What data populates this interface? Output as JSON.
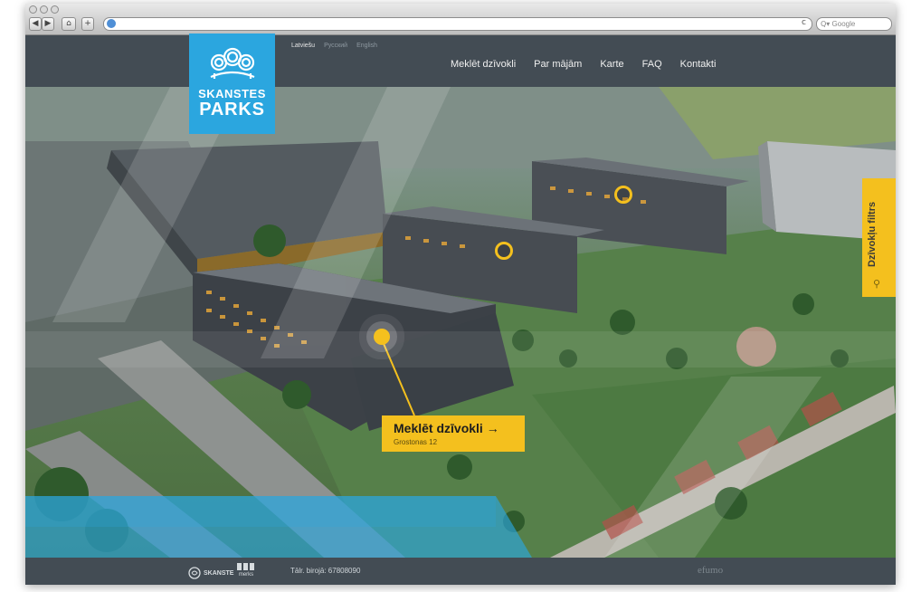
{
  "browser": {
    "url_value": "",
    "search_placeholder": "Google",
    "back_label": "◀",
    "forward_label": "▶",
    "home_label": "⌂",
    "add_label": "+",
    "reload_label": "c"
  },
  "brand": {
    "line1": "SKANSTES",
    "line2": "PARKS",
    "color": "#2ba6df"
  },
  "languages": [
    "Latviešu",
    "Русский",
    "English"
  ],
  "nav": {
    "items": [
      "Meklēt dzīvokli",
      "Par mājām",
      "Karte",
      "FAQ",
      "Kontakti"
    ]
  },
  "callout": {
    "title": "Meklēt dzīvokli →",
    "subtitle": "Grostonas 12",
    "color": "#f4c01e"
  },
  "filter_tab": {
    "label": "Dzīvokļu filtrs"
  },
  "footer": {
    "partner1": "SKANSTE",
    "partner2": "merks",
    "phone": "Tālr. birojā: 67808090",
    "developer": "efumo"
  }
}
